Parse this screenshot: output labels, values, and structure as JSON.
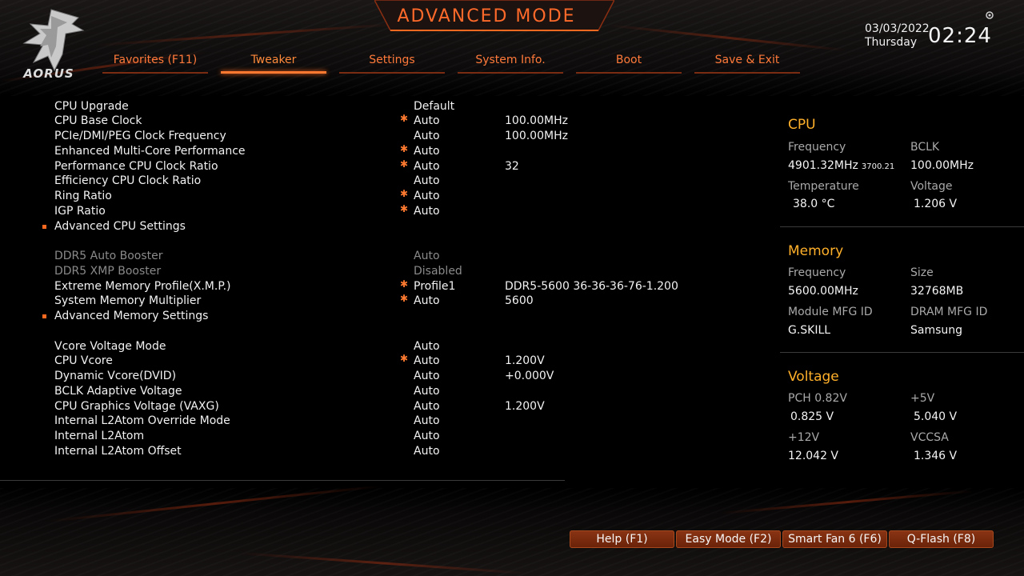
{
  "header": {
    "title": "ADVANCED MODE",
    "logo_text": "AORUS",
    "date": "03/03/2022",
    "day": "Thursday",
    "time": "02:24"
  },
  "tabs": [
    {
      "label": "Favorites (F11)",
      "active": false
    },
    {
      "label": "Tweaker",
      "active": true
    },
    {
      "label": "Settings",
      "active": false
    },
    {
      "label": "System Info.",
      "active": false
    },
    {
      "label": "Boot",
      "active": false
    },
    {
      "label": "Save & Exit",
      "active": false
    }
  ],
  "settings": [
    {
      "label": "CPU Upgrade",
      "value": "Default",
      "extra": "",
      "star": false,
      "submenu": false,
      "dim": false
    },
    {
      "label": "CPU Base Clock",
      "value": "Auto",
      "extra": "100.00MHz",
      "star": true,
      "submenu": false,
      "dim": false
    },
    {
      "label": "PCIe/DMI/PEG Clock Frequency",
      "value": "Auto",
      "extra": "100.00MHz",
      "star": false,
      "submenu": false,
      "dim": false
    },
    {
      "label": "Enhanced Multi-Core Performance",
      "value": "Auto",
      "extra": "",
      "star": true,
      "submenu": false,
      "dim": false
    },
    {
      "label": "Performance CPU Clock Ratio",
      "value": "Auto",
      "extra": "32",
      "star": true,
      "submenu": false,
      "dim": false
    },
    {
      "label": "Efficiency CPU Clock Ratio",
      "value": "Auto",
      "extra": "",
      "star": false,
      "submenu": false,
      "dim": false
    },
    {
      "label": "Ring Ratio",
      "value": "Auto",
      "extra": "",
      "star": true,
      "submenu": false,
      "dim": false
    },
    {
      "label": "IGP Ratio",
      "value": "Auto",
      "extra": "",
      "star": true,
      "submenu": false,
      "dim": false
    },
    {
      "label": "Advanced CPU Settings",
      "value": "",
      "extra": "",
      "star": false,
      "submenu": true,
      "dim": false
    },
    {
      "label": "DDR5 Auto Booster",
      "value": "Auto",
      "extra": "",
      "star": false,
      "submenu": false,
      "dim": true
    },
    {
      "label": "DDR5 XMP Booster",
      "value": "Disabled",
      "extra": "",
      "star": false,
      "submenu": false,
      "dim": true
    },
    {
      "label": "Extreme Memory Profile(X.M.P.)",
      "value": "Profile1",
      "extra": "DDR5-5600 36-36-36-76-1.200",
      "star": true,
      "submenu": false,
      "dim": false
    },
    {
      "label": "System Memory Multiplier",
      "value": "Auto",
      "extra": "5600",
      "star": true,
      "submenu": false,
      "dim": false
    },
    {
      "label": "Advanced Memory Settings",
      "value": "",
      "extra": "",
      "star": false,
      "submenu": true,
      "dim": false
    },
    {
      "label": "Vcore Voltage Mode",
      "value": "Auto",
      "extra": "",
      "star": false,
      "submenu": false,
      "dim": false
    },
    {
      "label": "CPU Vcore",
      "value": "Auto",
      "extra": "1.200V",
      "star": true,
      "submenu": false,
      "dim": false
    },
    {
      "label": "Dynamic Vcore(DVID)",
      "value": "Auto",
      "extra": "+0.000V",
      "star": false,
      "submenu": false,
      "dim": false
    },
    {
      "label": "BCLK Adaptive Voltage",
      "value": "Auto",
      "extra": "",
      "star": false,
      "submenu": false,
      "dim": false
    },
    {
      "label": "CPU Graphics Voltage (VAXG)",
      "value": "Auto",
      "extra": "1.200V",
      "star": false,
      "submenu": false,
      "dim": false
    },
    {
      "label": "Internal L2Atom Override Mode",
      "value": "Auto",
      "extra": "",
      "star": false,
      "submenu": false,
      "dim": false
    },
    {
      "label": "Internal L2Atom",
      "value": "Auto",
      "extra": "",
      "star": false,
      "submenu": false,
      "dim": false
    },
    {
      "label": "Internal L2Atom Offset",
      "value": "Auto",
      "extra": "",
      "star": false,
      "submenu": false,
      "dim": false
    }
  ],
  "info_panel": {
    "cpu": {
      "title": "CPU",
      "frequency_label": "Frequency",
      "frequency_value": "4901.32MHz",
      "frequency_sub": "3700.21",
      "bclk_label": "BCLK",
      "bclk_value": "100.00MHz",
      "temperature_label": "Temperature",
      "temperature_value": "38.0 °C",
      "voltage_label": "Voltage",
      "voltage_value": "1.206 V"
    },
    "memory": {
      "title": "Memory",
      "frequency_label": "Frequency",
      "frequency_value": "5600.00MHz",
      "size_label": "Size",
      "size_value": "32768MB",
      "module_label": "Module MFG ID",
      "module_value": "G.SKILL",
      "dram_label": "DRAM MFG ID",
      "dram_value": "Samsung"
    },
    "voltage": {
      "title": "Voltage",
      "pch_label": "PCH 0.82V",
      "pch_value": "0.825 V",
      "p5v_label": "+5V",
      "p5v_value": "5.040 V",
      "p12v_label": "+12V",
      "p12v_value": "12.042 V",
      "vccsa_label": "VCCSA",
      "vccsa_value": "1.346 V"
    }
  },
  "footer": {
    "buttons": [
      "Help (F1)",
      "Easy Mode (F2)",
      "Smart Fan 6 (F6)",
      "Q-Flash (F8)"
    ]
  },
  "colors": {
    "accent": "#ff7a30",
    "section_title": "#ffb02a",
    "button_bg": "#7a2a0e"
  }
}
